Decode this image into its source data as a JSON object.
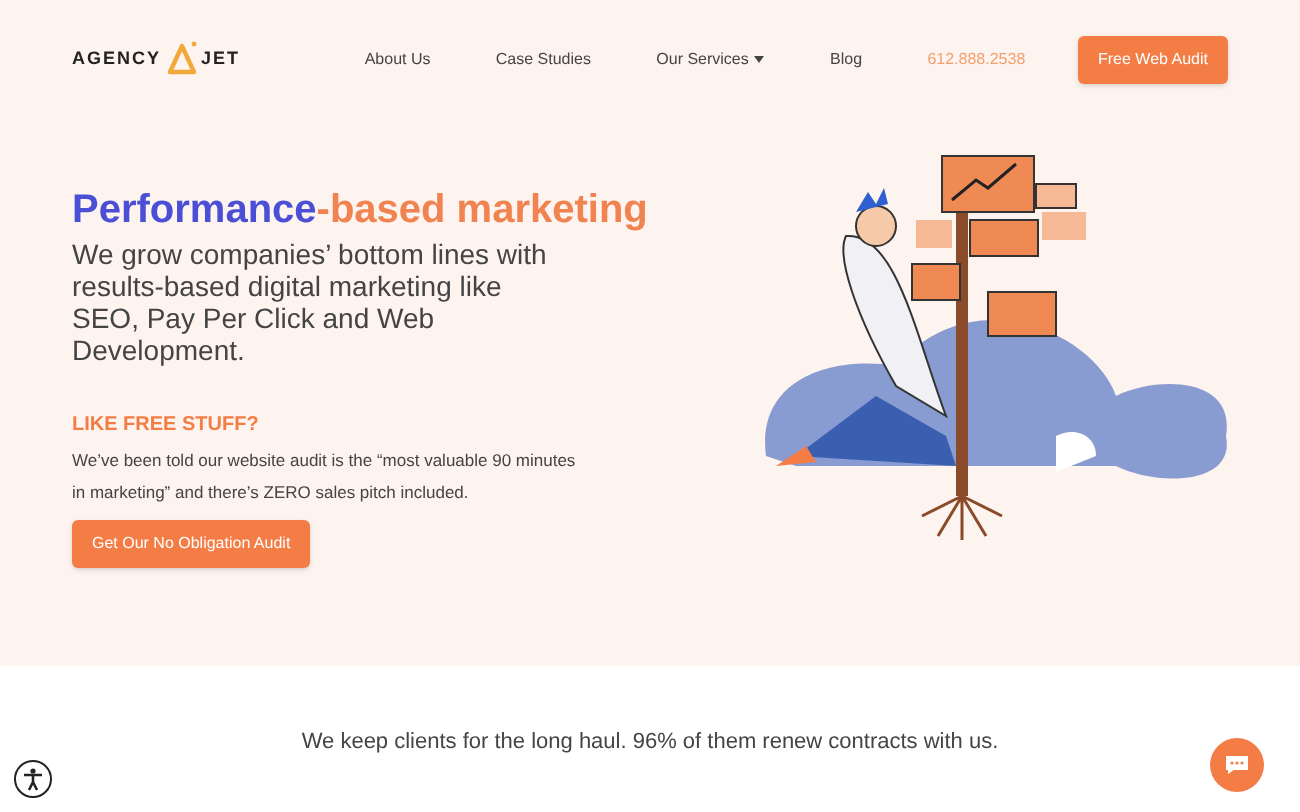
{
  "logo": {
    "left": "AGENCY",
    "right": "JET"
  },
  "nav": [
    {
      "label": "About Us",
      "kind": "link"
    },
    {
      "label": "Case Studies",
      "kind": "link"
    },
    {
      "label": "Our Services",
      "kind": "dropdown"
    },
    {
      "label": "Blog",
      "kind": "link"
    },
    {
      "label": "612.888.2538",
      "kind": "phone"
    }
  ],
  "cta": "Free Web Audit",
  "hero": {
    "headline": [
      "Performance",
      "-based marketing"
    ],
    "subhead": "We grow companies’ bottom lines with results-based digital marketing like SEO, Pay Per Click and Web Development.",
    "eyebrow": "LIKE FREE STUFF?",
    "body": "We’ve been told our website audit is the “most valuable 90 minutes in marketing” and there’s ZERO sales pitch included.",
    "button": "Get Our No Obligation Audit"
  },
  "tagline": "We keep clients for the long haul. 96% of them renew contracts with us."
}
